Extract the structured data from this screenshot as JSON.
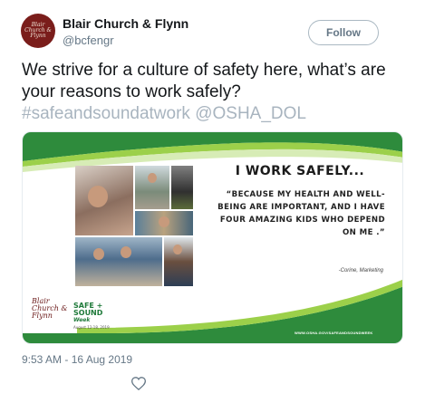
{
  "tweet": {
    "author": {
      "name": "Blair Church & Flynn",
      "handle": "@bcfengr",
      "avatar_text": "Blair Church & Flynn"
    },
    "follow_label": "Follow",
    "text": "We strive for a culture of safety here, what’s are your reasons to work safely?",
    "hashtag": "#safeandsoundatwork",
    "mention": "@OSHA_DOL",
    "timestamp": "9:53 AM - 16 Aug 2019",
    "like_icon": "heart-icon"
  },
  "media": {
    "headline": "I WORK SAFELY...",
    "quote": "“BECAUSE MY HEALTH AND WELL-BEING ARE IMPORTANT, AND I HAVE FOUR AMAZING KIDS WHO DEPEND ON ME .”",
    "attribution": "-Corine, Marketing",
    "logo_company": "Blair Church & Flynn",
    "logo_campaign_line1": "SAFE +",
    "logo_campaign_line2": "SOUND",
    "logo_campaign_line3": "Week",
    "logo_campaign_dates": "August 12-18, 2019",
    "footer_url": "WWW.OSHA.GOV/SAFEANDSOUNDWEEK",
    "colors": {
      "green_dark": "#2e8b3c",
      "green_light": "#9cd04a",
      "brand_maroon": "#7a1d1b"
    }
  }
}
